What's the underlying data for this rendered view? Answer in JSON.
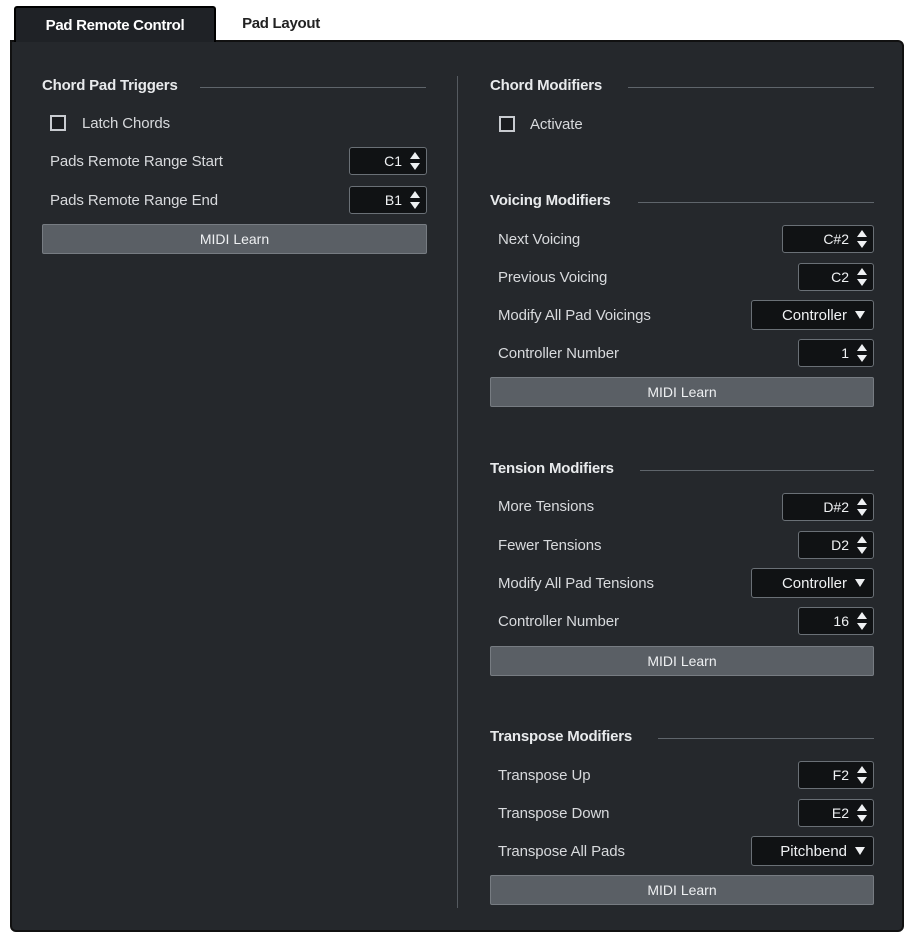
{
  "tabs": [
    {
      "label": "Pad Remote Control",
      "active": true
    },
    {
      "label": "Pad Layout",
      "active": false
    }
  ],
  "chord_pad_triggers": {
    "title": "Chord Pad Triggers",
    "latch_label": "Latch Chords",
    "latch_checked": false,
    "range_start_label": "Pads Remote Range Start",
    "range_start_value": "C1",
    "range_end_label": "Pads Remote Range End",
    "range_end_value": "B1",
    "midi_learn": "MIDI Learn"
  },
  "chord_modifiers": {
    "title": "Chord Modifiers",
    "activate_label": "Activate",
    "activate_checked": false
  },
  "voicing_modifiers": {
    "title": "Voicing Modifiers",
    "next_label": "Next Voicing",
    "next_value": "C#2",
    "previous_label": "Previous Voicing",
    "previous_value": "C2",
    "modify_all_label": "Modify All Pad Voicings",
    "modify_all_value": "Controller",
    "controller_label": "Controller Number",
    "controller_value": "1",
    "midi_learn": "MIDI Learn"
  },
  "tension_modifiers": {
    "title": "Tension Modifiers",
    "more_label": "More Tensions",
    "more_value": "D#2",
    "fewer_label": "Fewer Tensions",
    "fewer_value": "D2",
    "modify_all_label": "Modify All Pad Tensions",
    "modify_all_value": "Controller",
    "controller_label": "Controller Number",
    "controller_value": "16",
    "midi_learn": "MIDI Learn"
  },
  "transpose_modifiers": {
    "title": "Transpose Modifiers",
    "up_label": "Transpose Up",
    "up_value": "F2",
    "down_label": "Transpose Down",
    "down_value": "E2",
    "all_label": "Transpose All Pads",
    "all_value": "Pitchbend",
    "midi_learn": "MIDI Learn"
  }
}
